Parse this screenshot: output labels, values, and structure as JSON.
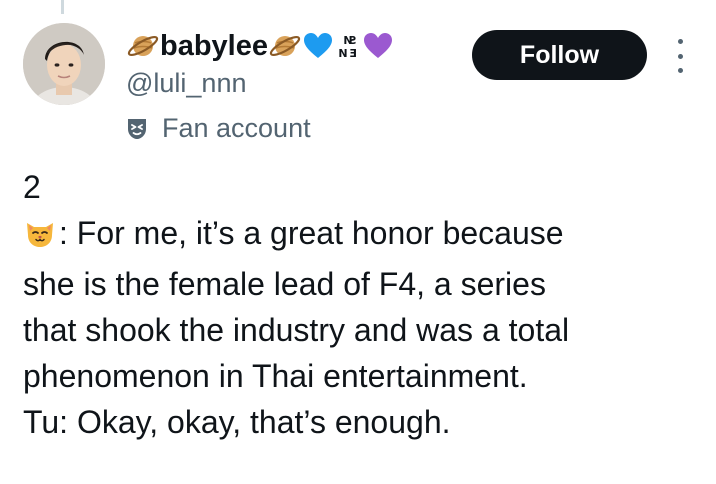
{
  "profile": {
    "display_name": "babylee",
    "name_emojis": [
      "ringed-planet-emoji",
      "ringed-planet-emoji",
      "blue-heart-emoji",
      "nct-logo",
      "purple-heart-emoji"
    ],
    "name_badge_text": "NCT",
    "handle": "@luli_nnn",
    "account_label": "Fan account",
    "account_label_icon": "mask-icon"
  },
  "actions": {
    "follow_label": "Follow",
    "more_icon": "more-vertical-icon"
  },
  "tweet": {
    "lines": [
      "2",
      ": For me, it’s a great honor because",
      "she is the female lead of F4, a series",
      "that shook the industry and was a total",
      "phenomenon in Thai entertainment.",
      "Tu: Okay, okay, that’s enough."
    ],
    "speaker_emoji": "cat-face-emoji"
  },
  "colors": {
    "text_primary": "#0f1419",
    "text_secondary": "#536471",
    "follow_bg": "#0f1419",
    "follow_text": "#ffffff",
    "blue_heart": "#1d9bf0",
    "purple_heart": "#9b59d0"
  }
}
